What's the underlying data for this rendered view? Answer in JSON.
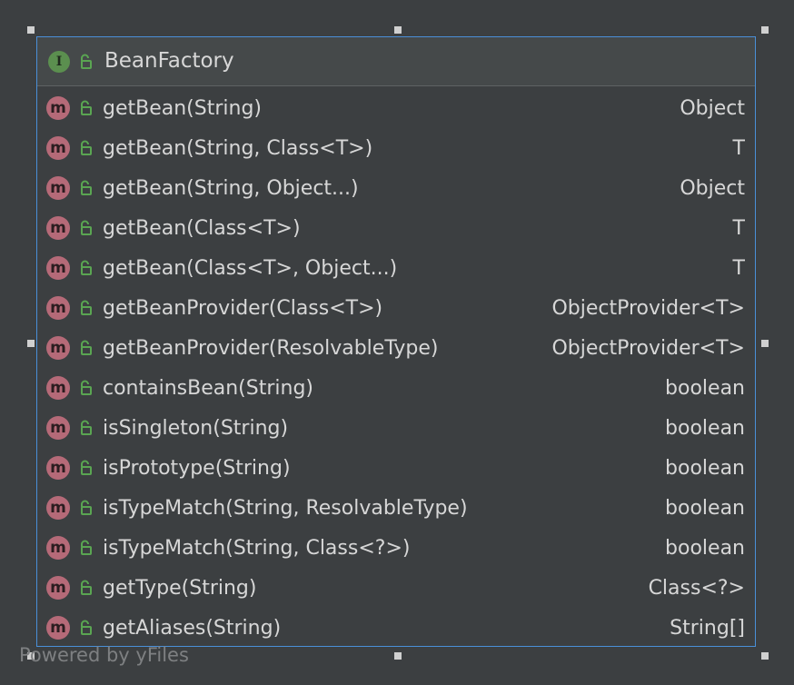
{
  "node": {
    "title": "BeanFactory",
    "kind_glyph": "I",
    "kind_icon": "interface-icon",
    "visibility_icon": "unlock-icon",
    "border_color": "#4a8fd8"
  },
  "members": [
    {
      "name": "getBean(String)",
      "type": "Object"
    },
    {
      "name": "getBean(String, Class<T>)",
      "type": "T"
    },
    {
      "name": "getBean(String, Object...)",
      "type": "Object"
    },
    {
      "name": "getBean(Class<T>)",
      "type": "T"
    },
    {
      "name": "getBean(Class<T>, Object...)",
      "type": "T"
    },
    {
      "name": "getBeanProvider(Class<T>)",
      "type": "ObjectProvider<T>"
    },
    {
      "name": "getBeanProvider(ResolvableType)",
      "type": "ObjectProvider<T>"
    },
    {
      "name": "containsBean(String)",
      "type": "boolean"
    },
    {
      "name": "isSingleton(String)",
      "type": "boolean"
    },
    {
      "name": "isPrototype(String)",
      "type": "boolean"
    },
    {
      "name": "isTypeMatch(String, ResolvableType)",
      "type": "boolean"
    },
    {
      "name": "isTypeMatch(String, Class<?>)",
      "type": "boolean"
    },
    {
      "name": "getType(String)",
      "type": "Class<?>"
    },
    {
      "name": "getAliases(String)",
      "type": "String[]"
    }
  ],
  "member_icon": {
    "glyph": "m",
    "icon": "method-icon"
  },
  "watermark": "Powered by yFiles"
}
